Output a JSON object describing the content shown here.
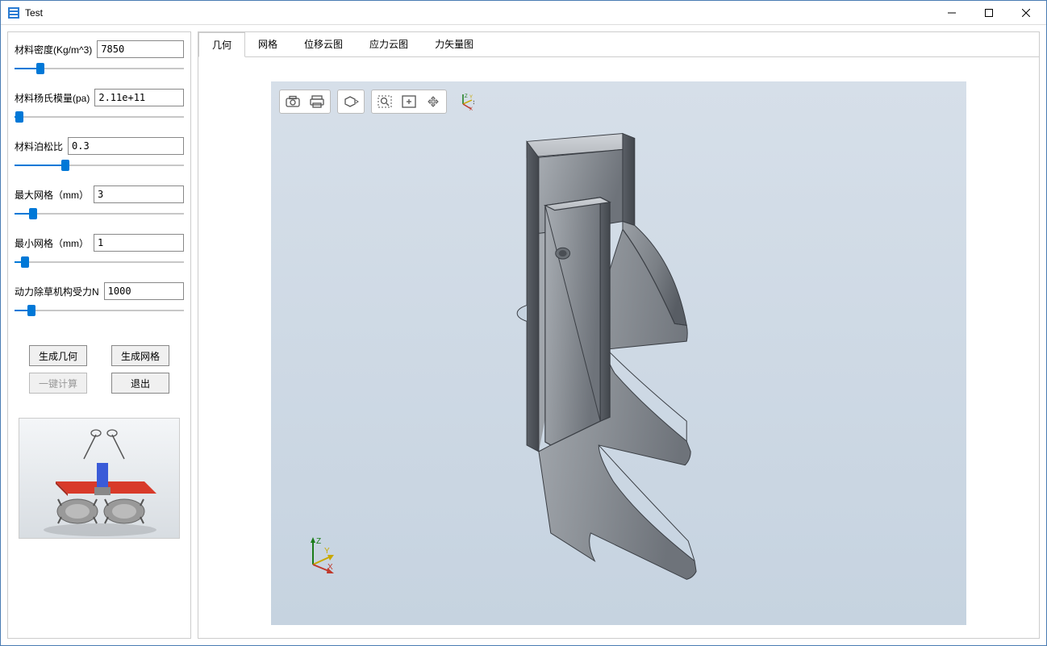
{
  "window": {
    "title": "Test"
  },
  "params": {
    "density": {
      "label": "材料密度(Kg/m^3)",
      "value": "7850",
      "pos": 15
    },
    "modulus": {
      "label": "材料杨氏模量(pa)",
      "value": "2.11e+11",
      "pos": 3
    },
    "poisson": {
      "label": "材料泊松比",
      "value": "0.3",
      "pos": 30
    },
    "maxmesh": {
      "label": "最大网格（mm）",
      "value": "3",
      "pos": 11
    },
    "minmesh": {
      "label": "最小网格（mm）",
      "value": "1",
      "pos": 6
    },
    "force": {
      "label": "动力除草机构受力N",
      "value": "1000",
      "pos": 10
    }
  },
  "buttons": {
    "gen_geom": "生成几何",
    "gen_mesh": "生成网格",
    "calc": "一键计算",
    "exit": "退出"
  },
  "tabs": [
    "几何",
    "网格",
    "位移云图",
    "应力云图",
    "力矢量图"
  ],
  "active_tab": 0,
  "axis": {
    "x": "X",
    "y": "Y",
    "z": "Z"
  }
}
